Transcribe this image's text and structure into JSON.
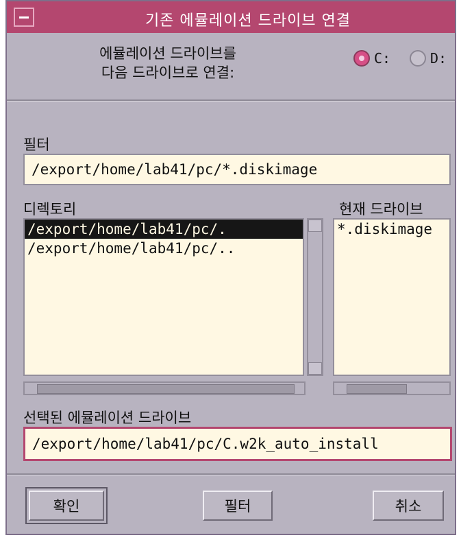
{
  "window": {
    "title": "기존 에뮬레이션 드라이브 연결"
  },
  "connect": {
    "label_line1": "에뮬레이션 드라이브를",
    "label_line2": "다음 드라이브로 연결:",
    "options": [
      {
        "label": "C:",
        "selected": true
      },
      {
        "label": "D:",
        "selected": false
      }
    ]
  },
  "filter": {
    "label": "필터",
    "value": "/export/home/lab41/pc/*.diskimage"
  },
  "directory": {
    "label": "디렉토리",
    "items": [
      "/export/home/lab41/pc/.",
      "/export/home/lab41/pc/.."
    ],
    "selected_index": 0
  },
  "current_drive": {
    "label": "현재 드라이브",
    "items": [
      "*.diskimage"
    ]
  },
  "selected_drive": {
    "label": "선택된 에뮬레이션 드라이브",
    "value": "/export/home/lab41/pc/C.w2k_auto_install"
  },
  "buttons": {
    "ok": "확인",
    "filter": "필터",
    "cancel": "취소"
  },
  "colors": {
    "titlebar": "#b4476f",
    "window_bg": "#b8b3c0",
    "field_bg": "#fff8e3",
    "radio_on": "#d64f86"
  }
}
